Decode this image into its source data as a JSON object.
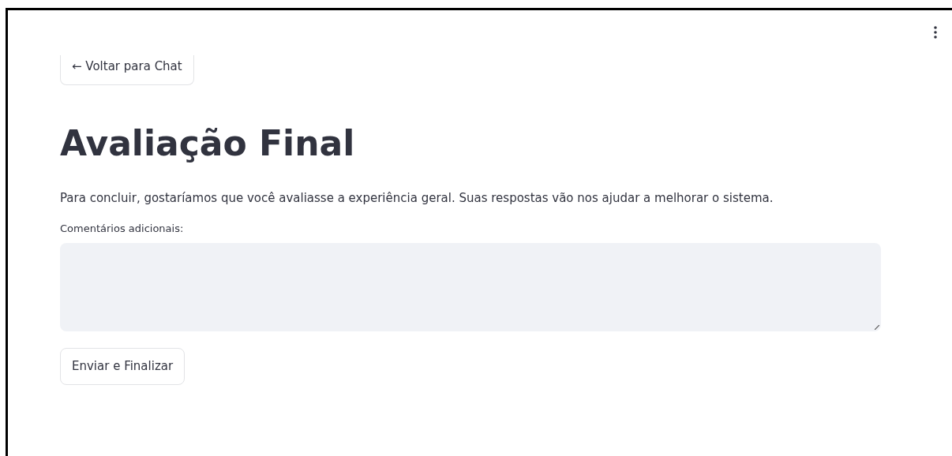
{
  "back_button": {
    "label": "← Voltar para Chat"
  },
  "title": "Avaliação Final",
  "intro": "Para concluir, gostaríamos que você avaliasse a experiência geral. Suas respostas vão nos ajudar a melhorar o sistema.",
  "comments": {
    "label": "Comentários adicionais:"
  },
  "submit_button": {
    "label": "Enviar e Finalizar"
  }
}
